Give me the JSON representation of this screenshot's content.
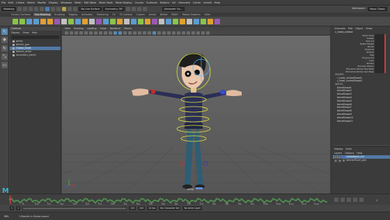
{
  "menubar": {
    "items": [
      "File",
      "Edit",
      "Create",
      "Select",
      "Modify",
      "Display",
      "Windows",
      "Mesh",
      "Edit Mesh",
      "Mesh Tools",
      "Mesh Display",
      "Curves",
      "Surfaces",
      "Deform",
      "UV",
      "Generate",
      "Cache",
      "Arnold",
      "Help"
    ],
    "workspace_label": "Workspace :",
    "workspace_value": "Maya Classic"
  },
  "statusline": {
    "mode": "Modeling",
    "no_live_surface": "No Live Surface",
    "symmetry": "Symmetry: Off",
    "sign_in": "Alexander Go..."
  },
  "shelf": {
    "tabs": [
      "Curves / Surfaces",
      "Poly Modeling",
      "Sculpting",
      "Rigging",
      "Animation",
      "Rendering",
      "FX",
      "FX Caching",
      "Custom",
      "Arnold",
      "Bifrost",
      "MASH",
      "Motion Graphics",
      "XGen"
    ],
    "active_tab": "Poly Modeling"
  },
  "toolbox": [
    "↖",
    "✥",
    "↻",
    "⤡",
    "▭"
  ],
  "outliner": {
    "title": "Outliner",
    "menus": [
      "Display",
      "Show",
      "Help"
    ],
    "items": [
      {
        "label": "persp",
        "selected": false
      },
      {
        "label": "blinnie_geo",
        "selected": false
      },
      {
        "label": "Global_Scale",
        "selected": true
      },
      {
        "label": "blinnie_mesh",
        "selected": false
      },
      {
        "label": "secondary_joints",
        "selected": false
      }
    ]
  },
  "viewport": {
    "menus": [
      "View",
      "Shading",
      "Lighting",
      "Show",
      "Renderer",
      "Panels"
    ],
    "camera_label": "persp"
  },
  "channelbox": {
    "tabs": [
      "Channels",
      "Edit",
      "Object",
      "Show"
    ],
    "node": "c_head_control",
    "attributes": [
      "Sparx Eyes",
      "Rotate",
      "Size Lid",
      "Eyelid Height",
      "Mouth",
      "Eyebrow",
      "Stretch",
      "Size",
      "Tongue Out",
      "Look",
      "Shader",
      "Thunder Sticker",
      "Phoneme Sticker Eye Base",
      "Phoneme Sticker Lips Base"
    ],
    "shapes_label": "SHAPES",
    "shapes": [
      "c_head_controlShape1",
      "c_head_controlShape2"
    ],
    "inputs_label": "INPUTS",
    "inputs": [
      "blendShape1",
      "blendShape2",
      "blendShape3",
      "blendShape4",
      "blendShape5",
      "blendShape6",
      "blendShape7",
      "blendShape8",
      "blendShape9",
      "blendShape10",
      "blendShape11"
    ]
  },
  "layers": {
    "tabs": [
      "Display",
      "Anim"
    ],
    "menus": [
      "Layers",
      "Options",
      "Help"
    ],
    "rows": [
      {
        "v": "V",
        "p": "P",
        "label": "controllayer_ctrl",
        "color": "#3a6bd0",
        "selected": true
      },
      {
        "v": "V",
        "p": "P",
        "label": "skinnedTouch_geo",
        "color": "#777777",
        "selected": false
      }
    ]
  },
  "timeline": {
    "logo": "M",
    "ticks": [
      "5",
      "10",
      "15",
      "20",
      "25",
      "30",
      "35",
      "40",
      "45",
      "50",
      "55",
      "60",
      "65",
      "70",
      "75",
      "80",
      "85",
      "90",
      "95",
      "100",
      "105",
      "110",
      "115",
      "120"
    ],
    "current_frame": "1"
  },
  "rangebar": {
    "start": "1",
    "inner_start": "1",
    "inner_end": "120",
    "end": "200",
    "fps": "24 fps",
    "char_set": "No Character Set",
    "anim_layer": "No Anim Layer"
  },
  "helpline": {
    "mel": "MEL",
    "message": "1 Results in Global saved"
  }
}
